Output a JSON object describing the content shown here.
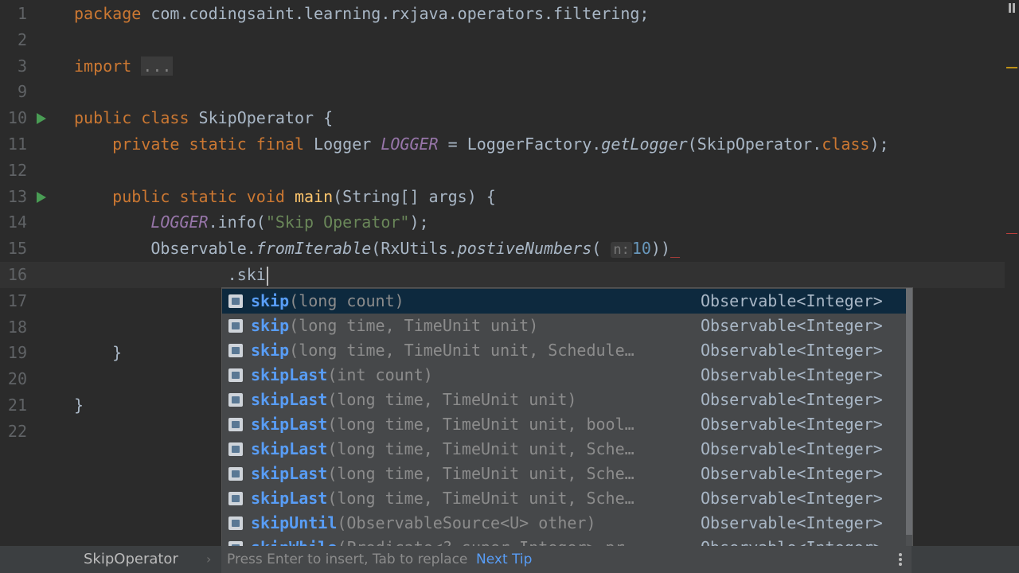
{
  "editor": {
    "lines": [
      {
        "n": "1",
        "parts": [
          {
            "c": "kw",
            "t": "package"
          },
          {
            "c": "",
            "t": " com.codingsaint.learning.rxjava.operators.filtering;"
          }
        ]
      },
      {
        "n": "2",
        "parts": []
      },
      {
        "n": "3",
        "parts": [
          {
            "c": "kw",
            "t": "import"
          },
          {
            "c": "",
            "t": " "
          },
          {
            "c": "fold",
            "t": "..."
          }
        ]
      },
      {
        "n": "9",
        "parts": []
      },
      {
        "n": "10",
        "run": true,
        "parts": [
          {
            "c": "kw",
            "t": "public class"
          },
          {
            "c": "",
            "t": " SkipOperator {"
          }
        ]
      },
      {
        "n": "11",
        "parts": [
          {
            "c": "",
            "t": "    "
          },
          {
            "c": "kw",
            "t": "private static final"
          },
          {
            "c": "",
            "t": " Logger "
          },
          {
            "c": "field",
            "t": "LOGGER"
          },
          {
            "c": "",
            "t": " = LoggerFactory."
          },
          {
            "c": "it",
            "t": "getLogger"
          },
          {
            "c": "",
            "t": "(SkipOperator."
          },
          {
            "c": "kw",
            "t": "class"
          },
          {
            "c": "",
            "t": ");"
          }
        ]
      },
      {
        "n": "12",
        "parts": []
      },
      {
        "n": "13",
        "run": true,
        "parts": [
          {
            "c": "",
            "t": "    "
          },
          {
            "c": "kw",
            "t": "public static void"
          },
          {
            "c": "",
            "t": " "
          },
          {
            "c": "fn",
            "t": "main"
          },
          {
            "c": "",
            "t": "(String[] args) {"
          }
        ]
      },
      {
        "n": "14",
        "parts": [
          {
            "c": "",
            "t": "        "
          },
          {
            "c": "field",
            "t": "LOGGER"
          },
          {
            "c": "",
            "t": ".info("
          },
          {
            "c": "str",
            "t": "\"Skip Operator\""
          },
          {
            "c": "",
            "t": ");"
          }
        ]
      },
      {
        "n": "15",
        "parts": [
          {
            "c": "",
            "t": "        Observable."
          },
          {
            "c": "it",
            "t": "fromIterable"
          },
          {
            "c": "",
            "t": "(RxUtils."
          },
          {
            "c": "it",
            "t": "postiveNumbers"
          },
          {
            "c": "",
            "t": "( "
          },
          {
            "c": "hint",
            "t": "n:"
          },
          {
            "c": "num",
            "t": "10"
          },
          {
            "c": "",
            "t": "))"
          },
          {
            "c": "wavy",
            "t": "_"
          }
        ]
      },
      {
        "n": "16",
        "current": true,
        "cursor": true,
        "parts": [
          {
            "c": "",
            "t": "                .ski"
          }
        ]
      },
      {
        "n": "17",
        "parts": []
      },
      {
        "n": "18",
        "parts": []
      },
      {
        "n": "19",
        "parts": [
          {
            "c": "",
            "t": "    }"
          }
        ]
      },
      {
        "n": "20",
        "parts": []
      },
      {
        "n": "21",
        "parts": [
          {
            "c": "",
            "t": "}"
          }
        ]
      },
      {
        "n": "22",
        "parts": []
      }
    ]
  },
  "completion": {
    "items": [
      {
        "match": "skip",
        "rest": "",
        "params": "(long count)",
        "ret": "Observable<Integer>",
        "selected": true
      },
      {
        "match": "skip",
        "rest": "",
        "params": "(long time, TimeUnit unit)",
        "ret": "Observable<Integer>"
      },
      {
        "match": "skip",
        "rest": "",
        "params": "(long time, TimeUnit unit, Schedule…",
        "ret": "Observable<Integer>"
      },
      {
        "match": "skip",
        "rest": "Last",
        "params": "(int count)",
        "ret": "Observable<Integer>"
      },
      {
        "match": "skip",
        "rest": "Last",
        "params": "(long time, TimeUnit unit)",
        "ret": "Observable<Integer>"
      },
      {
        "match": "skip",
        "rest": "Last",
        "params": "(long time, TimeUnit unit, bool…",
        "ret": "Observable<Integer>"
      },
      {
        "match": "skip",
        "rest": "Last",
        "params": "(long time, TimeUnit unit, Sche…",
        "ret": "Observable<Integer>"
      },
      {
        "match": "skip",
        "rest": "Last",
        "params": "(long time, TimeUnit unit, Sche…",
        "ret": "Observable<Integer>"
      },
      {
        "match": "skip",
        "rest": "Last",
        "params": "(long time, TimeUnit unit, Sche…",
        "ret": "Observable<Integer>"
      },
      {
        "match": "skip",
        "rest": "Until",
        "params": "(ObservableSource<U> other)",
        "ret": "Observable<Integer>"
      },
      {
        "match": "skip",
        "rest": "While",
        "params": "(Predicate<? super Integer> pr…",
        "ret": "Observable<Integer>"
      }
    ],
    "hint_text": "Press Enter to insert, Tab to replace",
    "next_tip": "Next Tip"
  },
  "statusbar": {
    "breadcrumb": "SkipOperator",
    "breadcrumb_arrow": "›"
  },
  "icons": {
    "run": "run-gutter-icon",
    "method": "method-icon",
    "pause": "pause-icon",
    "more": "more-vertical-icon"
  },
  "colors": {
    "background": "#2b2b2b",
    "keyword": "#cc7832",
    "string": "#6a8759",
    "field": "#9876aa",
    "function": "#ffc66d",
    "number": "#6897bb",
    "match": "#589df6",
    "popup_selected": "#0d293e"
  }
}
